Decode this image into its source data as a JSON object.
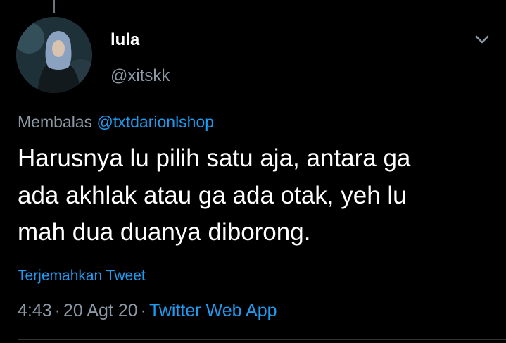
{
  "tweet": {
    "author": {
      "display_name": "lula",
      "handle": "@xitskk"
    },
    "reply": {
      "prefix": "Membalas",
      "mention": "@txtdarionlshop"
    },
    "text_lines": [
      "Harusnya lu pilih satu aja, antara ga",
      "ada akhlak atau ga ada otak, yeh lu",
      "mah dua duanya diborong."
    ],
    "translate_label": "Terjemahkan Tweet",
    "meta": {
      "time": "4:43",
      "separator": "·",
      "date": "20 Agt 20",
      "source": "Twitter Web App"
    },
    "icons": {
      "menu": "chevron-down-icon"
    }
  },
  "colors": {
    "background": "#000000",
    "text": "#ffffff",
    "secondary_text": "#8b98a5",
    "accent": "#1d9bf0"
  }
}
